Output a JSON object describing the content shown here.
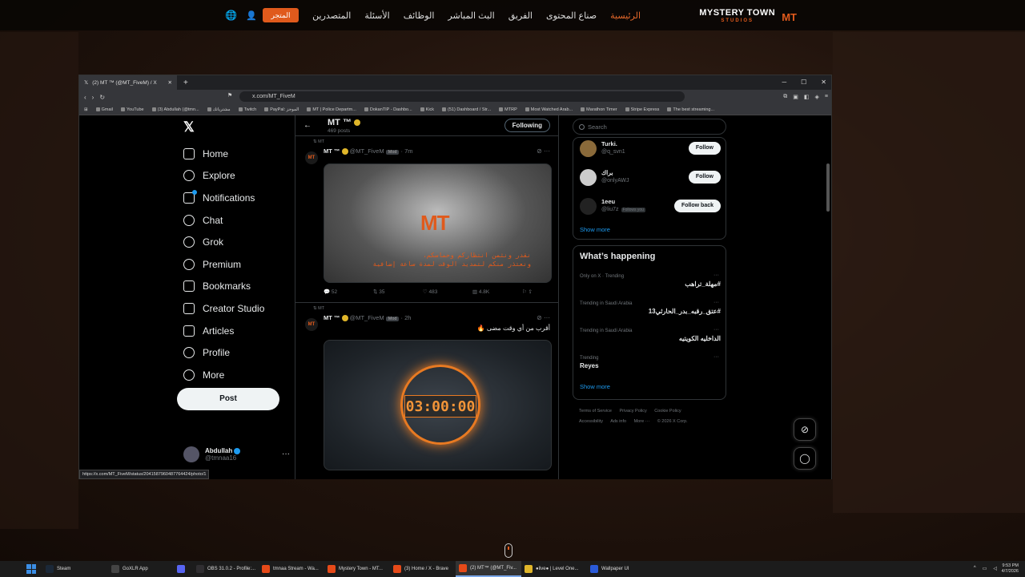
{
  "site": {
    "brand": "MYSTERY TOWN",
    "brand_sub": "STUDIOS",
    "brand_mark": "MT",
    "nav": [
      "الرئيسية",
      "صناع المحتوى",
      "الفريق",
      "البث المباشر",
      "الوظائف",
      "الأسئلة",
      "المتصدرين"
    ],
    "store": "المتجر"
  },
  "browser": {
    "tab_title": "(2) MT ™ (@MT_FiveM) / X",
    "url": "x.com/MT_FiveM",
    "bookmarks": [
      "Gmail",
      "YouTube",
      "(3) Abdullah (@tmn...",
      "مشترياتك",
      "Twitch",
      "PayPal: الموجز",
      "MT | Police Departm...",
      "DokanTIP - Dashbo...",
      "Kick",
      "(51) Dashboard / Str...",
      "MTRP",
      "Most Watched Arab...",
      "Marathon Timer",
      "Stripe Express",
      "The best streaming..."
    ],
    "status_url": "https://x.com/MT_FiveM/status/2041587960487764424/photo/1"
  },
  "x": {
    "nav": [
      "Home",
      "Explore",
      "Notifications",
      "Chat",
      "Grok",
      "Premium",
      "Bookmarks",
      "Creator Studio",
      "Articles",
      "Profile",
      "More"
    ],
    "post": "Post",
    "account": {
      "name": "Abdullah",
      "handle": "@tmnaa16"
    },
    "profile": {
      "name": "MT ™",
      "posts": "469 posts",
      "follow_state": "Following"
    },
    "tweets": [
      {
        "context": "MT",
        "name": "MT ™",
        "handle": "@MT_FiveM",
        "badge": "Mod",
        "time": "7m",
        "text": "",
        "media_logo": "MT",
        "media_text": "نقدر ونثمن انتظاركم وحماسكم،\nونعتذر منكم لتمديد الوقت لمدة ساعة إضافية",
        "replies": "52",
        "reposts": "35",
        "likes": "483",
        "views": "4.8K"
      },
      {
        "context": "MT",
        "name": "MT ™",
        "handle": "@MT_FiveM",
        "badge": "Mod",
        "time": "2h",
        "text": "أقرب من أي وقت مضى 🔥",
        "media_time": "03:00:00"
      }
    ],
    "search_placeholder": "Search",
    "who_to_follow": [
      {
        "name": "Turki.",
        "handle": "@q_svn1",
        "button": "Follow",
        "follows_you": ""
      },
      {
        "name": "براك",
        "handle": "@onlyAWJ",
        "button": "Follow",
        "follows_you": ""
      },
      {
        "name": "1eeu",
        "handle": "@liu7z",
        "button": "Follow back",
        "follows_you": "Follows you"
      }
    ],
    "show_more": "Show more",
    "trends_title": "What’s happening",
    "trends": [
      {
        "context": "Only on X · Trending",
        "tag": "#مهلة_تراهب"
      },
      {
        "context": "Trending in Saudi Arabia",
        "tag": "#عتق_رقبه_بدر_الحارثي13"
      },
      {
        "context": "Trending in Saudi Arabia",
        "tag": "الداخليه الكويتيه"
      },
      {
        "context": "Trending",
        "tag": "Reyes"
      }
    ],
    "footer": [
      "Terms of Service",
      "Privacy Policy",
      "Cookie Policy",
      "Accessibility",
      "Ads info",
      "More ···",
      "© 2026 X Corp."
    ]
  },
  "taskbar": {
    "items": [
      "Steam",
      "GoXLR App",
      "",
      "OBS 31.0.2 - Profile:...",
      "tmnaa Stream - Wa...",
      "Mystery Town - MT...",
      "(3) Home / X - Brave",
      "(2) MT™ (@MT_Fiv...",
      "●live● | Level One...",
      "Wallpaper UI"
    ],
    "time": "9:53 PM",
    "date": "4/7/2026"
  }
}
